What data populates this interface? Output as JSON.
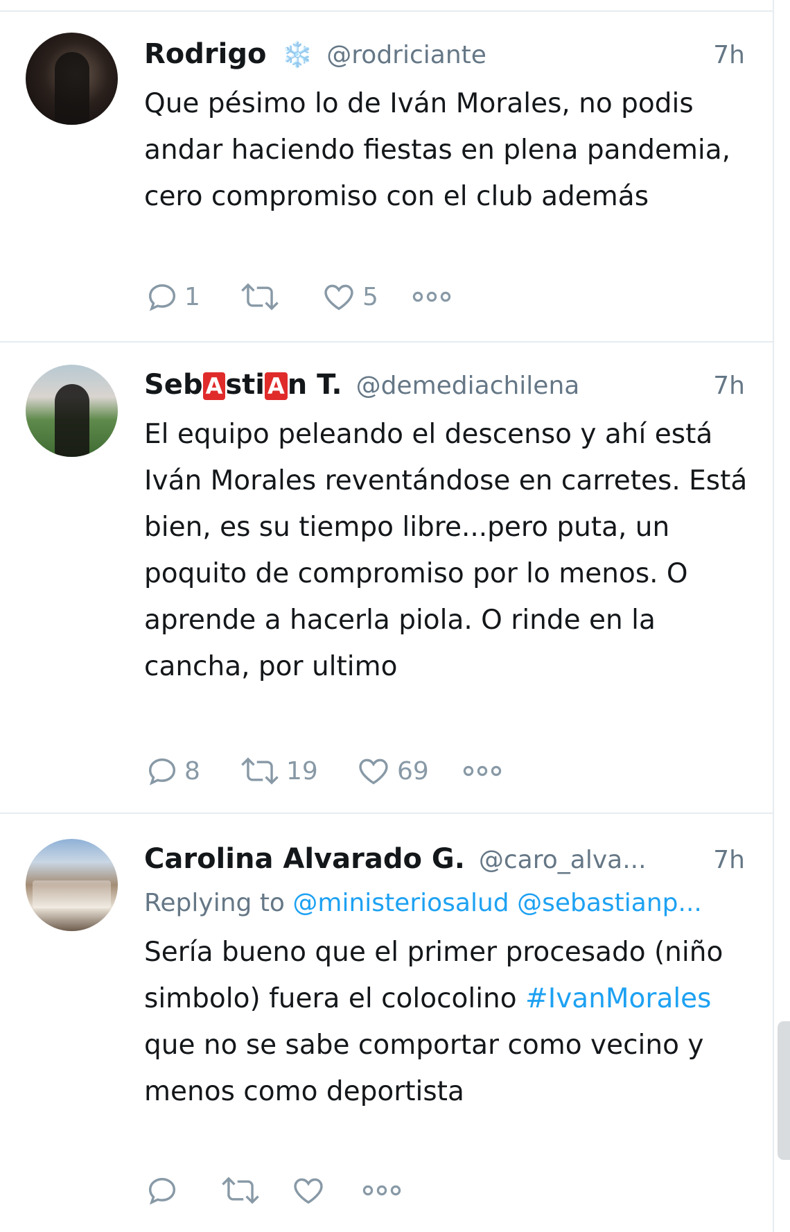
{
  "tweets": [
    {
      "name": "Rodrigo",
      "emoji": "❄️",
      "handle": "@rodriciante",
      "time": "7h",
      "text": "Que pésimo lo de Iván Morales, no podis andar haciendo fiestas en plena pandemia, cero compromiso con el club además",
      "replies": "1",
      "retweets": "",
      "likes": "5"
    },
    {
      "name_parts": [
        "Seb",
        "A",
        "sti",
        "A",
        "n T."
      ],
      "handle": "@demediachilena",
      "time": "7h",
      "text": "El equipo peleando el descenso y ahí está Iván Morales reventándose en carretes. Está bien, es su tiempo libre...pero puta, un poquito de compromiso por lo menos. O aprende a hacerla piola. O rinde en la cancha, por ultimo",
      "replies": "8",
      "retweets": "19",
      "likes": "69"
    },
    {
      "name": "Carolina Alvarado G.",
      "handle": "@caro_alva...",
      "time": "7h",
      "replying_label": "Replying to",
      "mentions": [
        "@ministeriosalud",
        "@sebastianp..."
      ],
      "text_before": "Sería bueno que el primer procesado (niño simbolo) fuera el colocolino",
      "hashtag": "#IvanMorales",
      "text_after": "que no se sabe comportar como vecino y menos como deportista",
      "replies": "",
      "retweets": "",
      "likes": ""
    }
  ],
  "icons": {
    "reply": "speech-bubble-icon",
    "retweet": "retweet-arrows-icon",
    "like": "heart-icon",
    "more": "more-dots-icon"
  },
  "colors": {
    "text": "#14171a",
    "secondary": "#657786",
    "link": "#1da1f2",
    "action": "#8899a6",
    "divider": "#e6ecf0",
    "badge": "#e02b2b"
  }
}
